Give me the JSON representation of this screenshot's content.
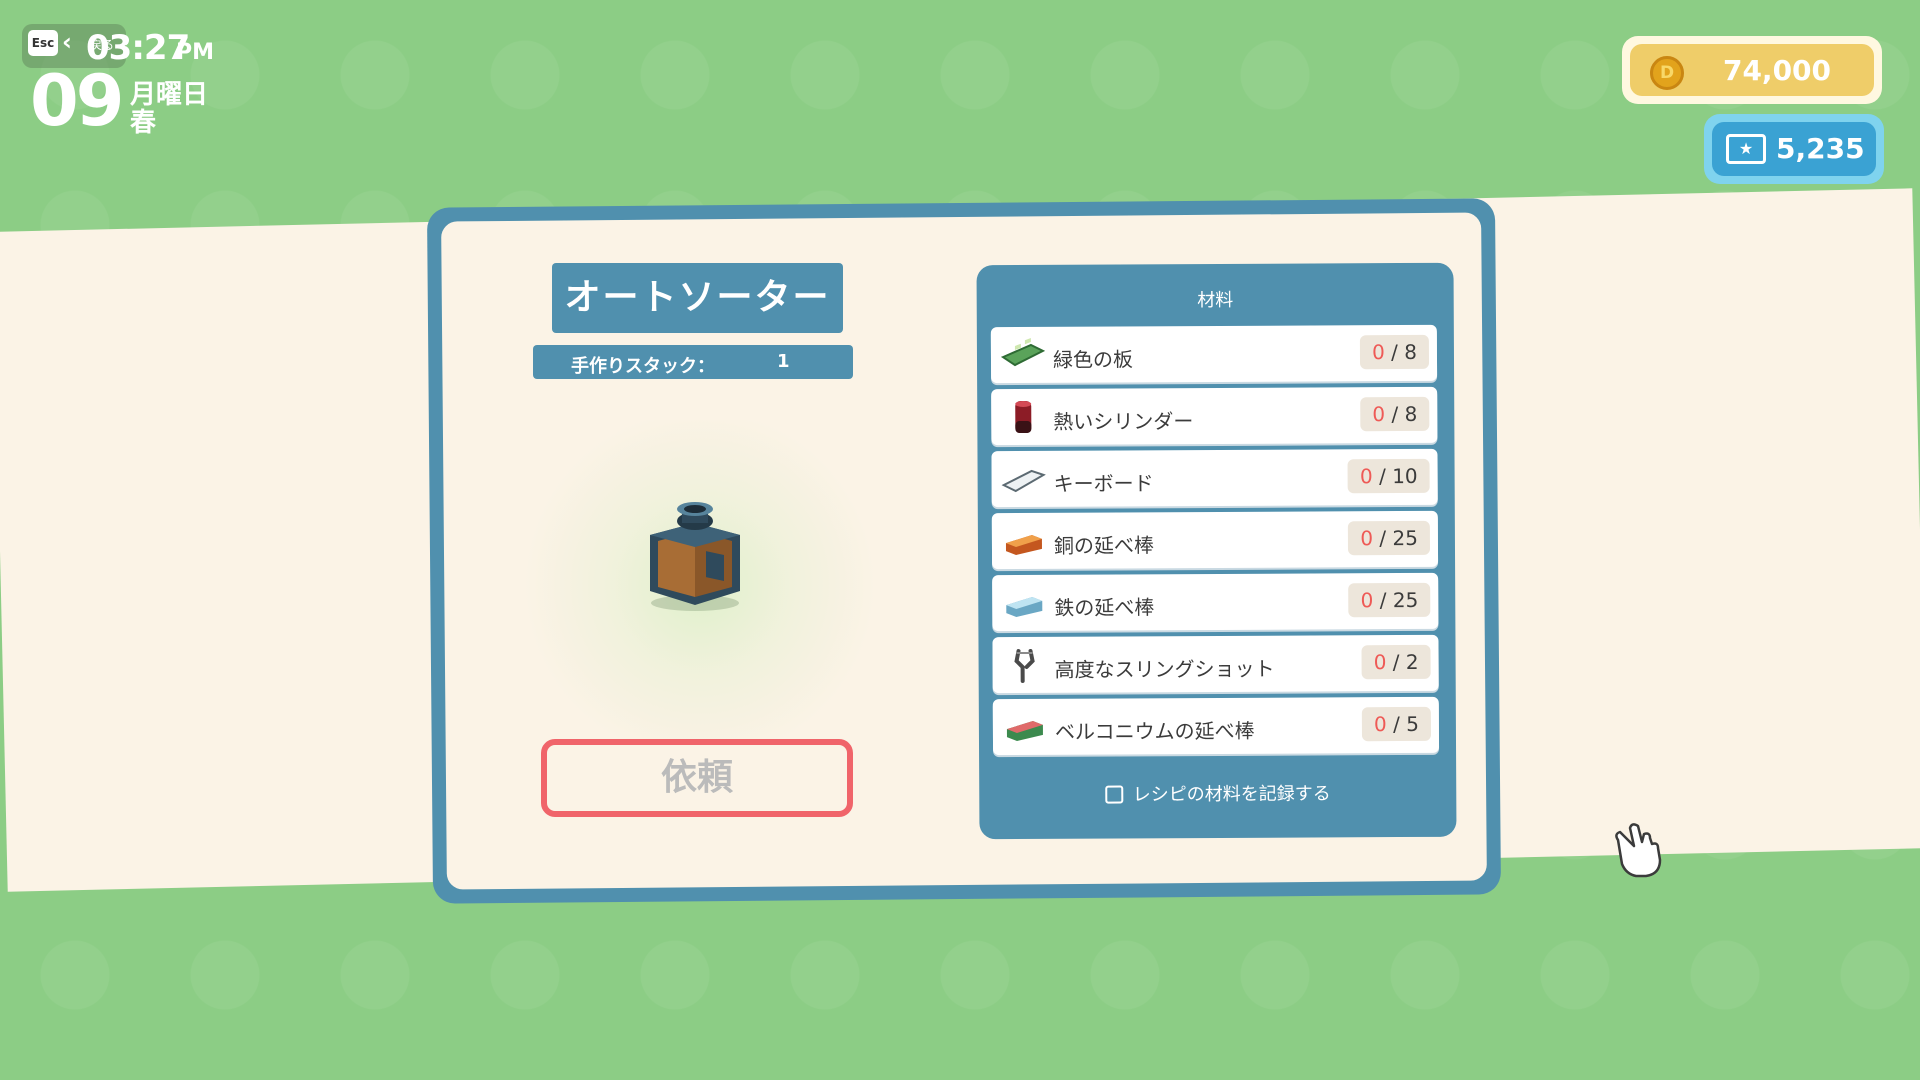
{
  "hud": {
    "esc_key": "Esc",
    "back_label": "戻る",
    "time": "03:27",
    "ampm": "PM",
    "day": "09",
    "weekday": "月曜日",
    "season": "春",
    "coins": "74,000",
    "tickets": "5,235"
  },
  "recipe": {
    "title": "オートソーター",
    "stack_label": "手作りスタック：",
    "stack_value": "1",
    "request_button": "依頼"
  },
  "materials": {
    "header": "材料",
    "items": [
      {
        "name": "緑色の板",
        "have": "0",
        "need": " / 8",
        "icon": "green-board-icon"
      },
      {
        "name": "熱いシリンダー",
        "have": "0",
        "need": " / 8",
        "icon": "hot-cylinder-icon"
      },
      {
        "name": "キーボード",
        "have": "0",
        "need": " / 10",
        "icon": "keyboard-icon"
      },
      {
        "name": "銅の延べ棒",
        "have": "0",
        "need": " / 25",
        "icon": "copper-bar-icon"
      },
      {
        "name": "鉄の延べ棒",
        "have": "0",
        "need": " / 25",
        "icon": "iron-bar-icon"
      },
      {
        "name": "高度なスリングショット",
        "have": "0",
        "need": " / 2",
        "icon": "slingshot-icon"
      },
      {
        "name": "ベルコニウムの延べ棒",
        "have": "0",
        "need": " / 5",
        "icon": "bellconium-bar-icon"
      }
    ],
    "record_label": "レシピの材料を記録する"
  },
  "colors": {
    "background_green": "#8ccd85",
    "panel_blue": "#5090ae",
    "cream": "#fbf3e6",
    "accent_red": "#f0646a",
    "coin_gold": "#efcd69",
    "ticket_blue": "#3aa2d3"
  }
}
